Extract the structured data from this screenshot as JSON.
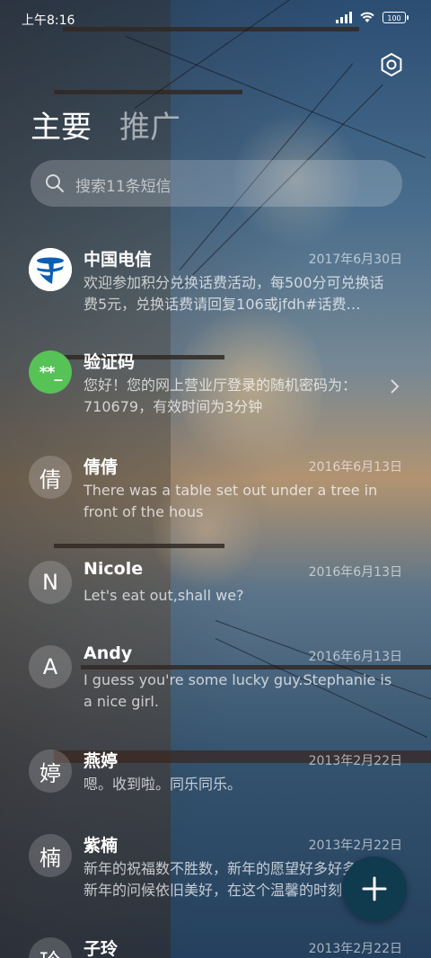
{
  "status_bar": {
    "time": "上午8:16",
    "battery": "100"
  },
  "tabs": {
    "main": "主要",
    "promo": "推广"
  },
  "search": {
    "placeholder": "搜索11条短信"
  },
  "messages": [
    {
      "avatar": "telecom-logo",
      "name": "中国电信",
      "date": "2017年6月30日",
      "preview": "欢迎参加积分兑换话费活动，每500分可兑换话费5元，兑换话费请回复106或jfdh#话费…"
    },
    {
      "avatar": "**_",
      "name": "验证码",
      "date": "",
      "preview": "您好！您的网上营业厅登录的随机密码为：710679，有效时间为3分钟"
    },
    {
      "avatar": "倩",
      "name": "倩倩",
      "date": "2016年6月13日",
      "preview": "There was a table set out under a tree in front of the hous"
    },
    {
      "avatar": "N",
      "name": "Nicole",
      "date": "2016年6月13日",
      "preview": "Let's eat out,shall we?"
    },
    {
      "avatar": "A",
      "name": "Andy",
      "date": "2016年6月13日",
      "preview": "I guess you're some lucky guy.Stephanie is a nice girl."
    },
    {
      "avatar": "婷",
      "name": "燕婷",
      "date": "2013年2月22日",
      "preview": "嗯。收到啦。同乐同乐。"
    },
    {
      "avatar": "楠",
      "name": "紫楠",
      "date": "2013年2月22日",
      "preview": "新年的祝福数不胜数，新年的愿望好多好多，新年的问候依旧美好，在这个温馨的时刻"
    },
    {
      "avatar": "玲",
      "name": "子玲",
      "date": "2013年2月22日",
      "preview": ""
    }
  ],
  "colors": {
    "fab": "#103a4e",
    "verify_avatar": "#57c256",
    "telecom_blue": "#0a5fb4"
  },
  "icons": {
    "settings": "gear-icon",
    "search": "search-icon",
    "compose": "plus-icon",
    "expand": "chevron-right-icon"
  }
}
